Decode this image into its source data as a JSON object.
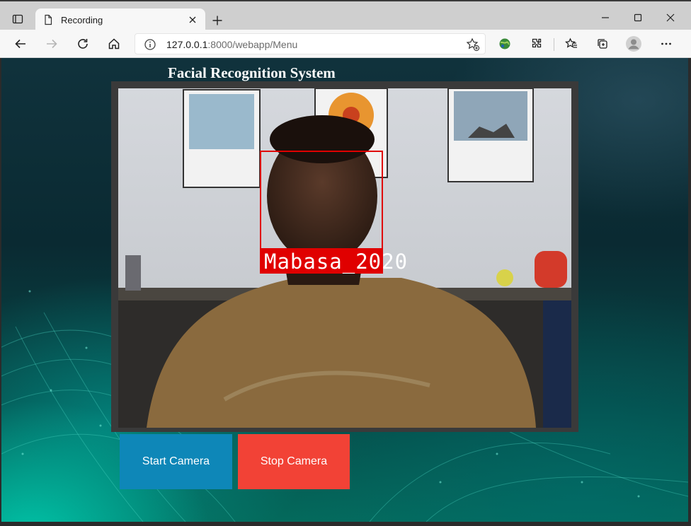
{
  "browser": {
    "tab_title": "Recording",
    "url_host": "127.0.0.1",
    "url_path": ":8000/webapp/Menu",
    "icons": [
      "tab-actions-icon",
      "page-icon",
      "close-icon",
      "plus-icon",
      "minimize-icon",
      "maximize-icon",
      "close-window-icon",
      "back-icon",
      "forward-icon",
      "refresh-icon",
      "home-icon",
      "info-icon",
      "add-favorite-icon",
      "extension-globe-icon",
      "extensions-icon",
      "favorites-icon",
      "collections-icon",
      "profile-icon",
      "more-icon"
    ]
  },
  "page": {
    "title": "Facial Recognition System",
    "detection_label": "Mabasa_2020",
    "start_button": "Start Camera",
    "stop_button": "Stop Camera"
  },
  "colors": {
    "start_button": "#0e87b8",
    "stop_button": "#f24236",
    "detection_box": "#e00000"
  }
}
